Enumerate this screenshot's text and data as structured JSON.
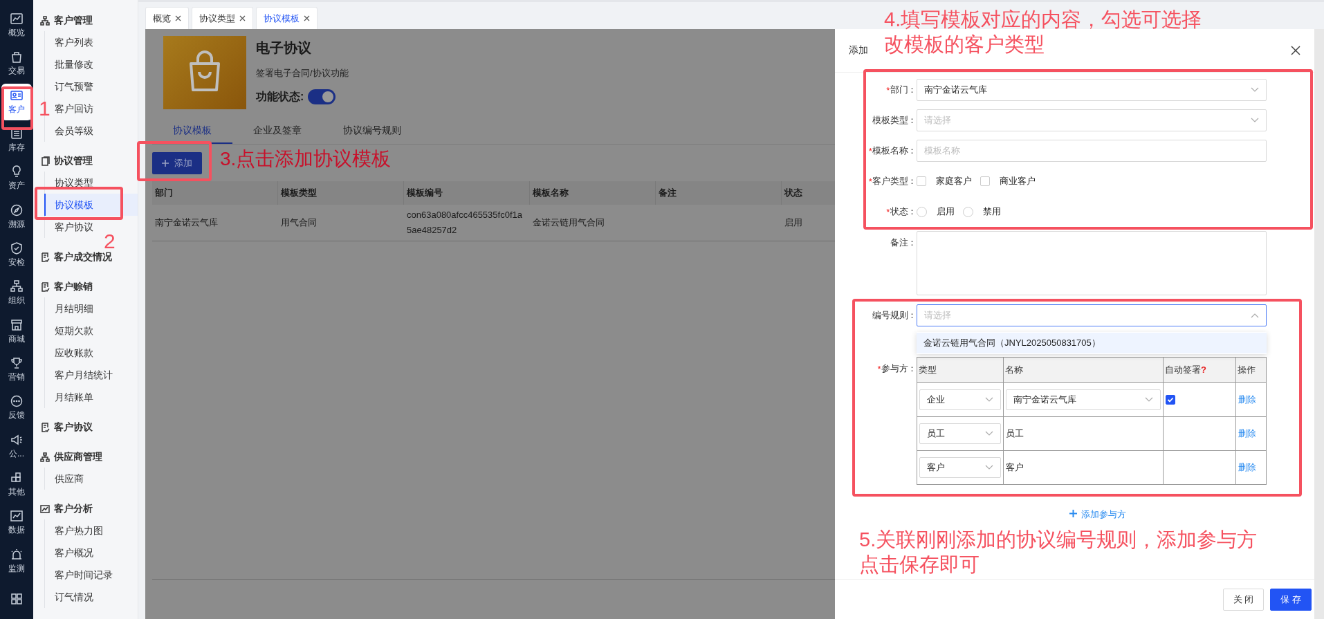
{
  "nav_rail": {
    "items": [
      {
        "label": "概览",
        "selected": false
      },
      {
        "label": "交易",
        "selected": false
      },
      {
        "label": "客户",
        "selected": true
      },
      {
        "label": "库存",
        "selected": false
      },
      {
        "label": "资产",
        "selected": false
      },
      {
        "label": "溯源",
        "selected": false
      },
      {
        "label": "安检",
        "selected": false
      },
      {
        "label": "组织",
        "selected": false
      },
      {
        "label": "商城",
        "selected": false
      },
      {
        "label": "营销",
        "selected": false
      },
      {
        "label": "反馈",
        "selected": false
      },
      {
        "label": "公...",
        "selected": false
      },
      {
        "label": "其他",
        "selected": false
      },
      {
        "label": "数据",
        "selected": false
      },
      {
        "label": "监测",
        "selected": false
      },
      {
        "selected": false
      }
    ]
  },
  "sidebar": {
    "groups": [
      {
        "title": "客户管理",
        "items": [
          {
            "label": "客户列表",
            "selected": false
          },
          {
            "label": "批量修改",
            "selected": false
          },
          {
            "label": "订气预警",
            "selected": false
          },
          {
            "label": "客户回访",
            "selected": false
          },
          {
            "label": "会员等级",
            "selected": false
          }
        ]
      },
      {
        "title": "协议管理",
        "items": [
          {
            "label": "协议类型",
            "selected": false
          },
          {
            "label": "协议模板",
            "selected": true
          },
          {
            "label": "客户协议",
            "selected": false
          }
        ]
      },
      {
        "title": "客户成交情况"
      },
      {
        "title": "客户赊销",
        "items": [
          {
            "label": "月结明细",
            "selected": false
          },
          {
            "label": "短期欠款",
            "selected": false
          },
          {
            "label": "应收账款",
            "selected": false
          },
          {
            "label": "客户月结统计",
            "selected": false
          },
          {
            "label": "月结账单",
            "selected": false
          }
        ]
      },
      {
        "title": "客户协议"
      },
      {
        "title": "供应商管理",
        "items": [
          {
            "label": "供应商",
            "selected": false
          }
        ]
      },
      {
        "title": "客户分析",
        "items": [
          {
            "label": "客户热力图",
            "selected": false
          },
          {
            "label": "客户概况",
            "selected": false
          },
          {
            "label": "客户时间记录",
            "selected": false
          },
          {
            "label": "订气情况",
            "selected": false
          }
        ]
      }
    ]
  },
  "tabs": [
    {
      "label": "概览",
      "selected": false
    },
    {
      "label": "协议类型",
      "selected": false
    },
    {
      "label": "协议模板",
      "selected": true
    }
  ],
  "module": {
    "title": "电子协议",
    "description": "签署电子合同/协议功能",
    "status_label": "功能状态:",
    "enabled": true
  },
  "sub_tabs": [
    {
      "label": "协议模板",
      "selected": true
    },
    {
      "label": "企业及签章",
      "selected": false
    },
    {
      "label": "协议编号规则",
      "selected": false
    }
  ],
  "toolbar": {
    "add_button": "添加"
  },
  "table": {
    "columns": [
      "部门",
      "模板类型",
      "模板编号",
      "模板名称",
      "备注",
      "状态"
    ],
    "rows": [
      [
        "南宁金诺云气库",
        "用气合同",
        "con63a080afcc465535fc0f1a5ae48257d2",
        "金诺云链用气合同",
        "",
        "启用"
      ]
    ]
  },
  "drawer": {
    "title": "添加",
    "fields": [
      {
        "kind": "select",
        "label": "部门：",
        "marker": "*",
        "value": "南宁金诺云气库"
      },
      {
        "kind": "select",
        "label": "模板类型：",
        "placeholder": "请选择"
      },
      {
        "kind": "input",
        "label": "模板名称：",
        "marker": "*",
        "placeholder": "模板名称"
      },
      {
        "kind": "checkboxes",
        "label": "客户类型：",
        "marker": "*",
        "options": [
          {
            "label": "家庭客户",
            "checked": false
          },
          {
            "label": "商业客户",
            "checked": false
          }
        ]
      },
      {
        "kind": "radios",
        "label": "状态：",
        "marker": "*",
        "options": [
          {
            "label": "启用",
            "selected": false
          },
          {
            "label": "禁用",
            "selected": false
          }
        ]
      },
      {
        "kind": "textarea",
        "label": "备注："
      },
      {
        "kind": "select",
        "label": "编号规则：",
        "placeholder": "请选择",
        "open": true,
        "options": [
          {
            "label": "金诺云链用气合同（JNYL2025050831705）",
            "highlighted": true
          }
        ]
      }
    ],
    "participants": {
      "label": "参与方：",
      "marker": "*",
      "columns": [
        {
          "label": "类型"
        },
        {
          "label": "名称"
        },
        {
          "label": "自动签署",
          "help": "?"
        },
        {
          "label": "操作"
        }
      ],
      "rows": [
        {
          "type": "企业",
          "kind": "select",
          "name": "南宁金诺云气库",
          "auto_sign": true,
          "action": "删除"
        },
        {
          "type": "员工",
          "kind": "text",
          "name": "员工",
          "action": "删除"
        },
        {
          "type": "客户",
          "kind": "text",
          "name": "客户",
          "action": "删除"
        }
      ]
    },
    "add_link": "添加参与方",
    "buttons": [
      {
        "label": "关 闭",
        "kind": "default"
      },
      {
        "label": "保 存",
        "kind": "primary"
      }
    ]
  },
  "annotations": [
    {
      "text": "1"
    },
    {
      "text": "2"
    },
    {
      "text": "3.点击添加协议模板"
    },
    {
      "text": "4.填写模板对应的内容，勾选可选择改模板的客户类型"
    },
    {
      "text": "5.关联刚刚添加的协议编号规则，添加参与方点击保存即可"
    }
  ]
}
